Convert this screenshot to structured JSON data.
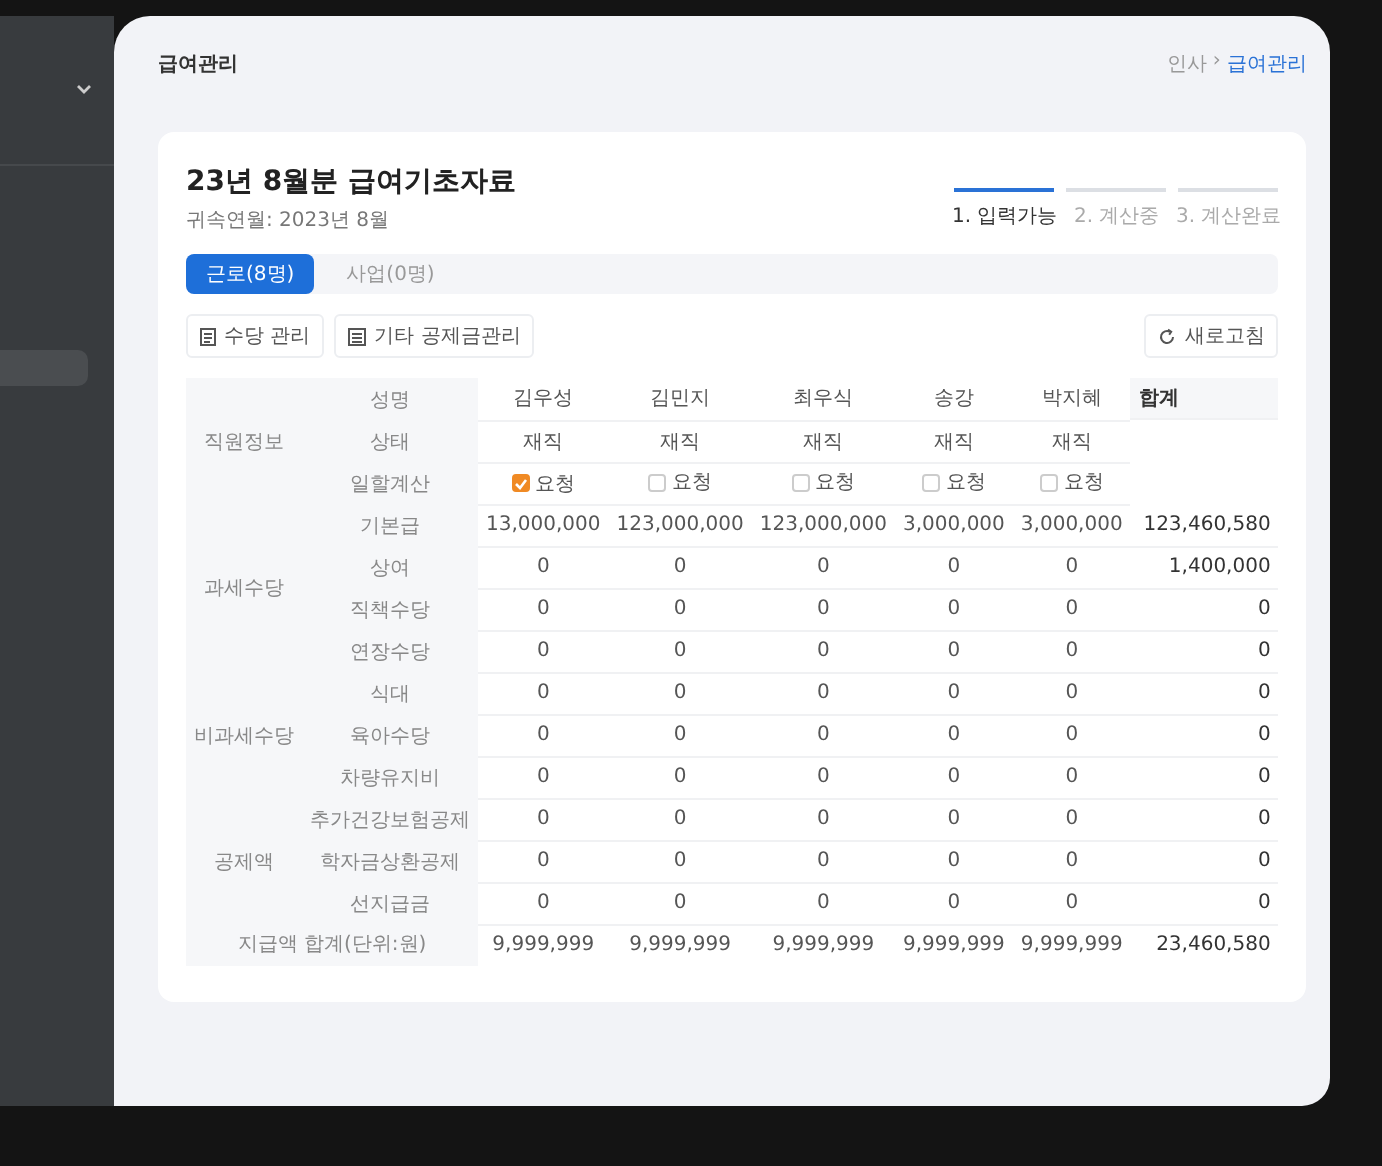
{
  "page_title": "급여관리",
  "breadcrumb": [
    {
      "label": "인사",
      "selected": false
    },
    {
      "label": "급여관리",
      "selected": true
    }
  ],
  "breadcrumb_separator": "›",
  "card": {
    "title": "23년 8월분 급여기초자료",
    "subtitle": "귀속연월: 2023년 8월"
  },
  "steps": [
    {
      "label": "1. 입력가능",
      "selected": true
    },
    {
      "label": "2. 계산중",
      "selected": false
    },
    {
      "label": "3. 계산완료",
      "selected": false
    }
  ],
  "tabs": [
    {
      "label": "근로(8명)",
      "selected": true
    },
    {
      "label": "사업(0명)",
      "selected": false
    }
  ],
  "toolbar": {
    "buttons": [
      "수당 관리",
      "기타 공제금관리"
    ],
    "refresh": "새로고침"
  },
  "employee_info": {
    "group": "직원정보",
    "total_header": "합계",
    "rows": [
      {
        "label": "성명",
        "values": [
          "김우성",
          "김민지",
          "최우식",
          "송강",
          "박지혜"
        ]
      },
      {
        "label": "상태",
        "values": [
          "재직",
          "재직",
          "재직",
          "재직",
          "재직"
        ]
      },
      {
        "label": "일할계산",
        "checks": [
          {
            "label": "요청",
            "checked": true
          },
          {
            "label": "요청",
            "checked": false
          },
          {
            "label": "요청",
            "checked": false
          },
          {
            "label": "요청",
            "checked": false
          },
          {
            "label": "요청",
            "checked": false
          }
        ]
      }
    ]
  },
  "amount_groups": [
    {
      "group": "과세수당",
      "rows": [
        {
          "label": "기본급",
          "values": [
            "13,000,000",
            "123,000,000",
            "123,000,000",
            "3,000,000",
            "3,000,000"
          ],
          "total": "123,460,580"
        },
        {
          "label": "상여",
          "values": [
            "0",
            "0",
            "0",
            "0",
            "0"
          ],
          "total": "1,400,000"
        },
        {
          "label": "직책수당",
          "values": [
            "0",
            "0",
            "0",
            "0",
            "0"
          ],
          "total": "0"
        },
        {
          "label": "연장수당",
          "values": [
            "0",
            "0",
            "0",
            "0",
            "0"
          ],
          "total": "0"
        }
      ]
    },
    {
      "group": "비과세수당",
      "rows": [
        {
          "label": "식대",
          "values": [
            "0",
            "0",
            "0",
            "0",
            "0"
          ],
          "total": "0"
        },
        {
          "label": "육아수당",
          "values": [
            "0",
            "0",
            "0",
            "0",
            "0"
          ],
          "total": "0"
        },
        {
          "label": "차량유지비",
          "values": [
            "0",
            "0",
            "0",
            "0",
            "0"
          ],
          "total": "0"
        }
      ]
    },
    {
      "group": "공제액",
      "rows": [
        {
          "label": "추가건강보험공제",
          "values": [
            "0",
            "0",
            "0",
            "0",
            "0"
          ],
          "total": "0"
        },
        {
          "label": "학자금상환공제",
          "values": [
            "0",
            "0",
            "0",
            "0",
            "0"
          ],
          "total": "0"
        },
        {
          "label": "선지급금",
          "values": [
            "0",
            "0",
            "0",
            "0",
            "0"
          ],
          "total": "0"
        }
      ]
    }
  ],
  "footer": {
    "label": "지급액 합계(단위:원)",
    "values": [
      "9,999,999",
      "9,999,999",
      "9,999,999",
      "9,999,999",
      "9,999,999"
    ],
    "total": "23,460,580"
  }
}
